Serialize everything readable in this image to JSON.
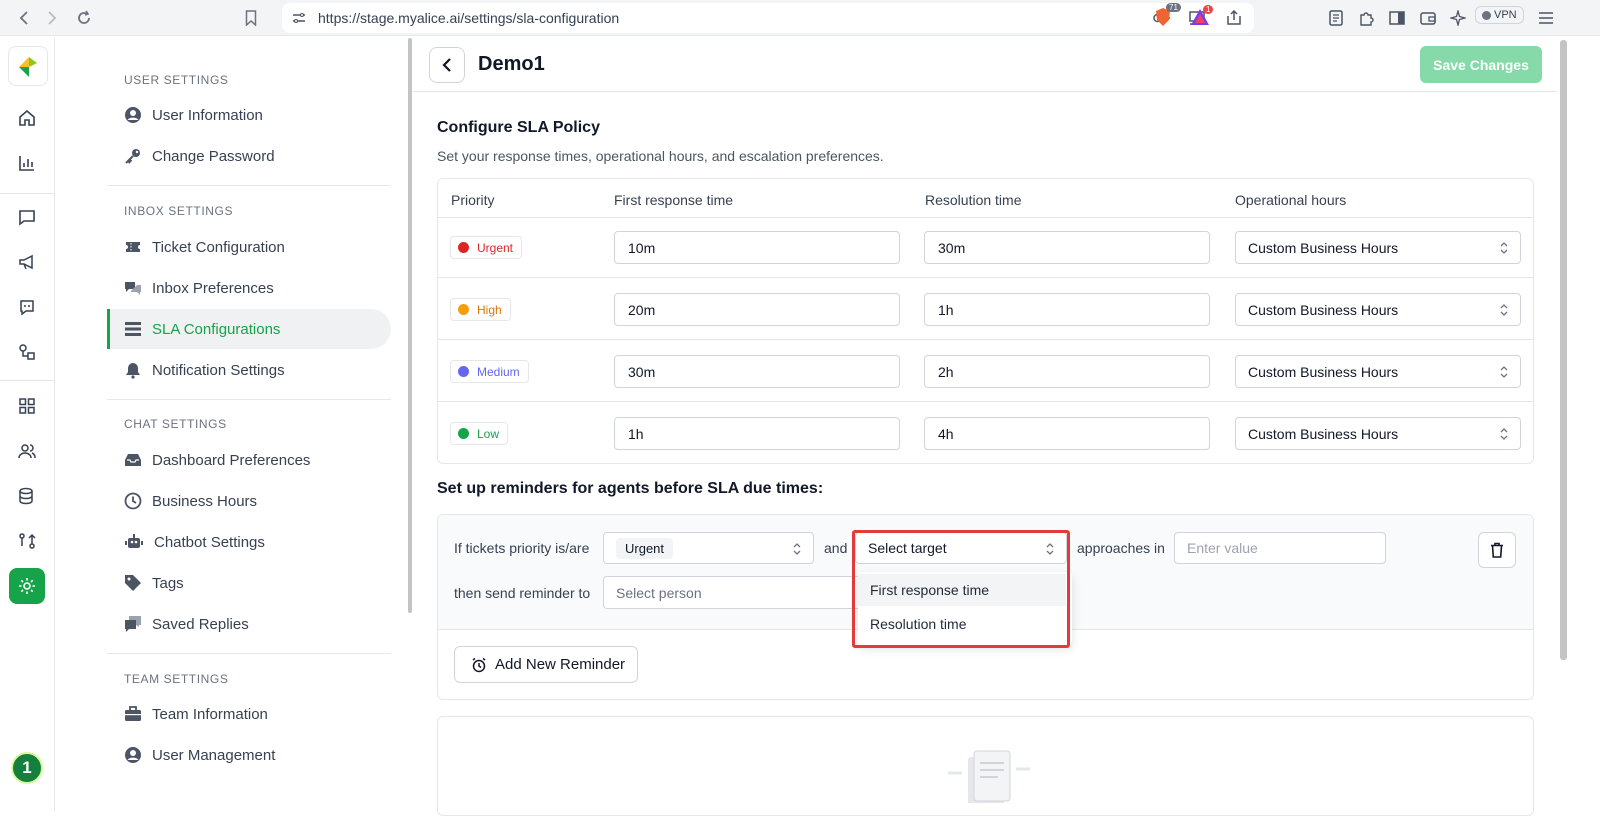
{
  "browser": {
    "url": "https://stage.myalice.ai/settings/sla-configuration",
    "brave_badge": "71",
    "alert_badge": "1",
    "vpn_label": "VPN"
  },
  "rail": {
    "avatar_label": "1",
    "icons": [
      "home-icon",
      "analytics-icon",
      "inbox-icon",
      "broadcast-icon",
      "bot-icon",
      "integration-icon",
      "apps-icon",
      "customers-icon",
      "data-lab-icon",
      "workflow-icon",
      "settings-icon"
    ]
  },
  "sidebar": {
    "sections": [
      {
        "title": "USER SETTINGS",
        "items": [
          "User Information",
          "Change Password"
        ]
      },
      {
        "title": "INBOX SETTINGS",
        "items": [
          "Ticket Configuration",
          "Inbox Preferences",
          "SLA Configurations",
          "Notification Settings"
        ]
      },
      {
        "title": "CHAT SETTINGS",
        "items": [
          "Dashboard Preferences",
          "Business Hours",
          "Chatbot Settings",
          "Tags",
          "Saved Replies"
        ]
      },
      {
        "title": "TEAM SETTINGS",
        "items": [
          "Team Information",
          "User Management"
        ]
      }
    ],
    "active_item": "SLA Configurations"
  },
  "header": {
    "title": "Demo1",
    "save_label": "Save Changes"
  },
  "config": {
    "title": "Configure SLA Policy",
    "subtitle": "Set your response times, operational hours, and escalation preferences.",
    "columns": [
      "Priority",
      "First response time",
      "Resolution time",
      "Operational hours"
    ],
    "rows": [
      {
        "priority": "Urgent",
        "color": "#dc2626",
        "first_response": "10m",
        "resolution": "30m",
        "hours": "Custom Business Hours"
      },
      {
        "priority": "High",
        "color": "#f59e0b",
        "first_response": "20m",
        "resolution": "1h",
        "hours": "Custom Business Hours"
      },
      {
        "priority": "Medium",
        "color": "#6366f1",
        "first_response": "30m",
        "resolution": "2h",
        "hours": "Custom Business Hours"
      },
      {
        "priority": "Low",
        "color": "#16a34a",
        "first_response": "1h",
        "resolution": "4h",
        "hours": "Custom Business Hours"
      }
    ]
  },
  "reminders": {
    "title": "Set up reminders for agents before SLA due times:",
    "if_label": "If tickets priority is/are",
    "priority_chip": "Urgent",
    "and_label": "and",
    "target_placeholder": "Select target",
    "approaches_label": "approaches in",
    "value_placeholder": "Enter value",
    "then_label": "then send reminder to",
    "person_placeholder": "Select person",
    "target_options": [
      "First response time",
      "Resolution time"
    ],
    "add_label": "Add New Reminder"
  }
}
